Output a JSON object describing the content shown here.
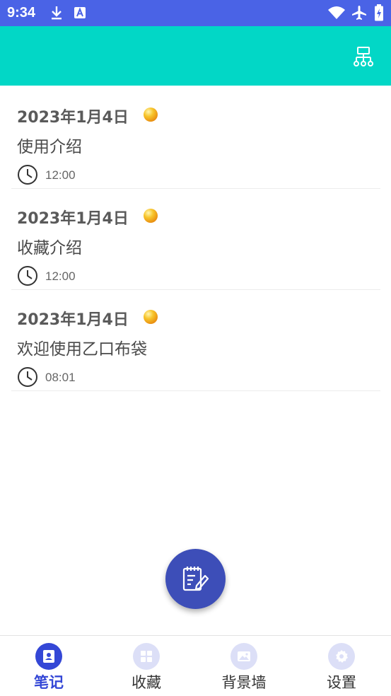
{
  "status_bar": {
    "time": "9:34"
  },
  "notes": [
    {
      "date": "2023年1月4日",
      "title": "使用介绍",
      "time": "12:00"
    },
    {
      "date": "2023年1月4日",
      "title": "收藏介绍",
      "time": "12:00"
    },
    {
      "date": "2023年1月4日",
      "title": "欢迎使用乙口布袋",
      "time": "08:01"
    }
  ],
  "bottom_nav": {
    "items": [
      {
        "label": "笔记",
        "icon": "contact-icon",
        "active": true
      },
      {
        "label": "收藏",
        "icon": "grid-icon",
        "active": false
      },
      {
        "label": "背景墙",
        "icon": "image-icon",
        "active": false
      },
      {
        "label": "设置",
        "icon": "gear-icon",
        "active": false
      }
    ]
  },
  "colors": {
    "status_bar": "#4a63e6",
    "toolbar": "#02d7c6",
    "fab": "#3d4eb8",
    "accent": "#3447d6"
  }
}
